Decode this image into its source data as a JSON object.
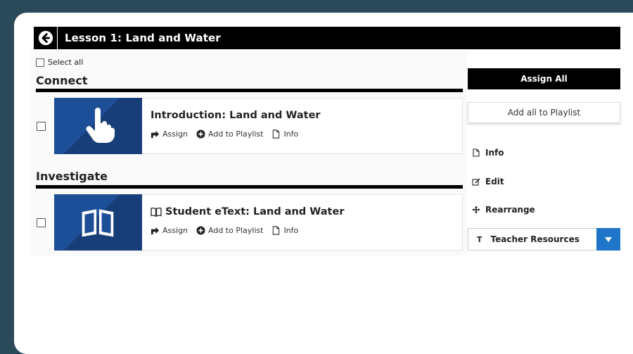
{
  "header": {
    "title": "Lesson 1: Land and Water"
  },
  "select_all_label": "Select all",
  "sections": [
    {
      "title": "Connect"
    },
    {
      "title": "Investigate"
    }
  ],
  "items": [
    {
      "title": "Introduction: Land and Water",
      "thumb_icon": "hand-pointer-icon"
    },
    {
      "title": "Student eText: Land and Water",
      "thumb_icon": "open-book-icon"
    }
  ],
  "actions": {
    "assign": "Assign",
    "add_to_playlist": "Add to Playlist",
    "info": "Info"
  },
  "sidebar": {
    "assign_all": "Assign All",
    "add_all_to_playlist": "Add all to Playlist",
    "info": "Info",
    "edit": "Edit",
    "rearrange": "Rearrange",
    "dropdown_icon": "T",
    "dropdown_label": "Teacher Resources"
  },
  "colors": {
    "frame": "#2a4a5a",
    "thumb": "#1d4f99",
    "dropdown_arrow": "#1f76c8",
    "header": "#000000"
  }
}
